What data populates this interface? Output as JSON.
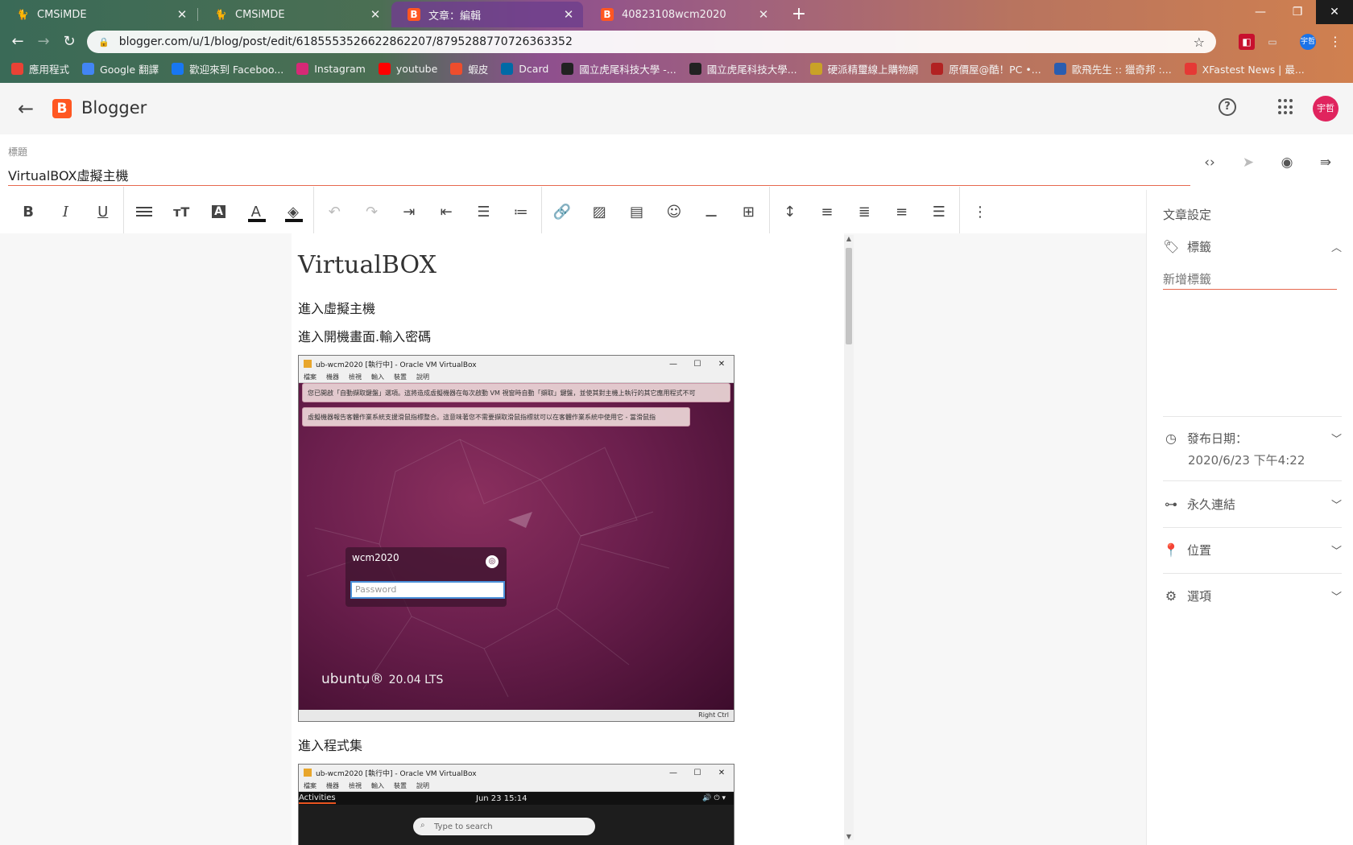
{
  "browser": {
    "tabs": [
      {
        "title": "CMSiMDE",
        "active": false
      },
      {
        "title": "CMSiMDE",
        "active": false
      },
      {
        "title": "文章：編輯",
        "active": true
      },
      {
        "title": "40823108wcm2020",
        "active": false
      }
    ],
    "new_tab": "+",
    "url": "blogger.com/u/1/blog/post/edit/6185553526622862207/8795288770726363352",
    "profile_label": "宇哲",
    "bookmarks": [
      {
        "label": "應用程式",
        "color": "#e94235"
      },
      {
        "label": "Google 翻譯",
        "color": "#4285f4"
      },
      {
        "label": "歡迎來到 Faceboo...",
        "color": "#1877f2"
      },
      {
        "label": "Instagram",
        "color": "#d62976"
      },
      {
        "label": "youtube",
        "color": "#ff0000"
      },
      {
        "label": "蝦皮",
        "color": "#ee4d2d"
      },
      {
        "label": "Dcard",
        "color": "#006aa6"
      },
      {
        "label": "國立虎尾科技大學 -...",
        "color": "#222222"
      },
      {
        "label": "國立虎尾科技大學...",
        "color": "#222222"
      },
      {
        "label": "硬派精璽線上購物網",
        "color": "#c9a227"
      },
      {
        "label": "原價屋@酷！PC •...",
        "color": "#b22222"
      },
      {
        "label": "歐飛先生 :: 獵奇邦 :...",
        "color": "#2a5db0"
      },
      {
        "label": "XFastest News | 最...",
        "color": "#e53935"
      }
    ]
  },
  "header": {
    "app_name": "Blogger",
    "logo_letter": "B",
    "avatar_label": "宇哲"
  },
  "post": {
    "title_label": "標題",
    "title_value": "VirtualBOX虛擬主機",
    "heading": "VirtualBOX",
    "para1": "進入虛擬主機",
    "para2": "進入開機畫面.輸入密碼",
    "para3": "進入程式集"
  },
  "vm1": {
    "window_title": "ub-wcm2020 [執行中] - Oracle VM VirtualBox",
    "menu": [
      "檔案",
      "機器",
      "檢視",
      "輸入",
      "裝置",
      "說明"
    ],
    "notice1": "您已開啟「自動擷取鍵盤」選項。這將造成虛擬機器在每次啟動 VM 視窗時自動「擷取」鍵盤，並使其對主機上執行的其它應用程式不可",
    "notice2": "虛擬機器報告客體作業系統支援滑鼠指標整合。這意味著您不需要擷取滑鼠指標就可以在客體作業系統中使用它 - 當滑鼠指",
    "login_user": "wcm2020",
    "password_placeholder": "Password",
    "os_name": "ubuntu®",
    "os_version": "20.04 LTS",
    "status_right": "Right Ctrl"
  },
  "vm2": {
    "window_title": "ub-wcm2020 [執行中] - Oracle VM VirtualBox",
    "menu": [
      "檔案",
      "機器",
      "檢視",
      "輸入",
      "裝置",
      "說明"
    ],
    "activities": "Activities",
    "clock": "Jun 23  15:14",
    "search_placeholder": "Type to search"
  },
  "side_panel": {
    "heading": "文章設定",
    "labels_title": "標籤",
    "labels_placeholder": "新增標籤",
    "publish_title": "發布日期：",
    "publish_value": "2020/6/23 下午4:22",
    "permalink": "永久連結",
    "location": "位置",
    "options": "選項"
  }
}
